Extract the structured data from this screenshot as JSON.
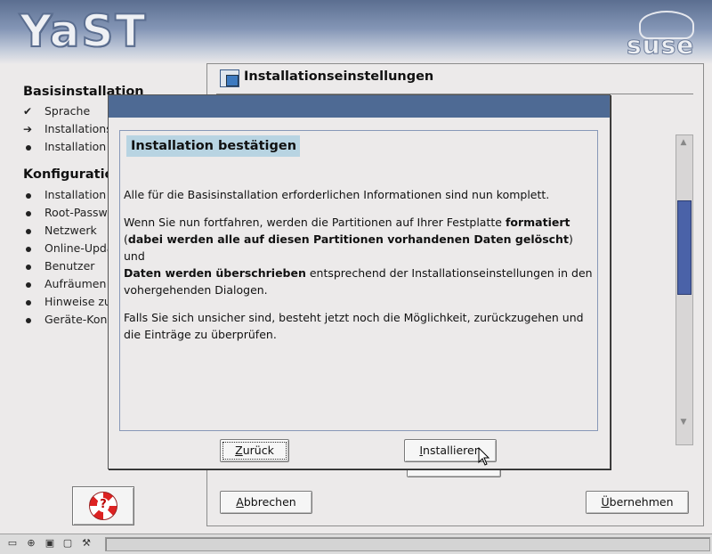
{
  "header": {
    "app_logo": "YaST",
    "vendor_logo": "suse"
  },
  "sidebar": {
    "section1_title": "Basisinstallation",
    "section1_items": [
      {
        "label": "Sprache",
        "state": "done",
        "icon": "check-icon"
      },
      {
        "label": "Installations",
        "state": "current",
        "icon": "arrow-right-icon"
      },
      {
        "label": "Installation",
        "state": "pending",
        "icon": "bullet-icon"
      }
    ],
    "section2_title": "Konfiguratio",
    "section2_items": [
      {
        "label": "Installation"
      },
      {
        "label": "Root-Passw"
      },
      {
        "label": "Netzwerk"
      },
      {
        "label": "Online-Upda"
      },
      {
        "label": "Benutzer"
      },
      {
        "label": "Aufräumen"
      },
      {
        "label": "Hinweise zu"
      },
      {
        "label": "Geräte-Kon"
      }
    ],
    "help_icon": "lifebuoy-help-icon"
  },
  "main": {
    "title": "Installationseinstellungen",
    "title_icon": "installation-settings-icon",
    "cancel_label": "Abbrechen",
    "cancel_mnemonic": "A",
    "cancel_rest": "bbrechen",
    "accept_label": "Übernehmen",
    "accept_mnemonic": "Ü",
    "accept_rest": "bernehmen"
  },
  "dialog": {
    "heading": "Installation bestätigen",
    "p1": "Alle für die Basisinstallation erforderlichen Informationen sind nun komplett.",
    "p2_a": "Wenn Sie nun fortfahren, werden die Partitionen auf Ihrer Festplatte ",
    "p2_b": "formatiert",
    "p2_c": "(",
    "p2_d": "dabei werden alle auf diesen Partitionen vorhandenen Daten gelöscht",
    "p2_e": ") und ",
    "p2_f": "Daten werden überschrieben",
    "p2_g": " entsprechend der Installationseinstellungen in den vohergehenden Dialogen.",
    "p3": "Falls Sie sich unsicher sind, besteht jetzt noch die Möglichkeit, zurückzugehen und die Einträge zu überprüfen.",
    "back_label": "Zurück",
    "back_mnemonic": "Z",
    "back_rest": "urück",
    "install_label": "Installieren",
    "install_mnemonic": "I",
    "install_rest": "nstallieren"
  },
  "taskbar": {
    "icons": [
      "drive-icon",
      "network-icon",
      "floppy-icon",
      "folder-icon",
      "tools-icon"
    ]
  }
}
